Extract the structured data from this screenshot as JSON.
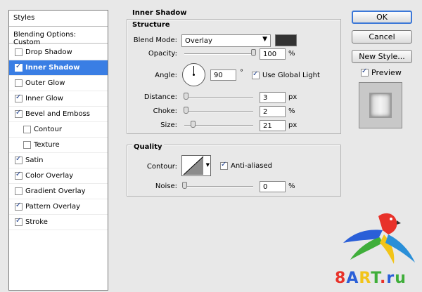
{
  "styles_panel": {
    "header": "Styles",
    "blending_options": "Blending Options: Custom",
    "items": [
      {
        "label": "Drop Shadow",
        "checked": false,
        "selected": false,
        "sub": false
      },
      {
        "label": "Inner Shadow",
        "checked": true,
        "selected": true,
        "sub": false
      },
      {
        "label": "Outer Glow",
        "checked": false,
        "selected": false,
        "sub": false
      },
      {
        "label": "Inner Glow",
        "checked": true,
        "selected": false,
        "sub": false
      },
      {
        "label": "Bevel and Emboss",
        "checked": true,
        "selected": false,
        "sub": false
      },
      {
        "label": "Contour",
        "checked": false,
        "selected": false,
        "sub": true
      },
      {
        "label": "Texture",
        "checked": false,
        "selected": false,
        "sub": true
      },
      {
        "label": "Satin",
        "checked": true,
        "selected": false,
        "sub": false
      },
      {
        "label": "Color Overlay",
        "checked": true,
        "selected": false,
        "sub": false
      },
      {
        "label": "Gradient Overlay",
        "checked": false,
        "selected": false,
        "sub": false
      },
      {
        "label": "Pattern Overlay",
        "checked": true,
        "selected": false,
        "sub": false
      },
      {
        "label": "Stroke",
        "checked": true,
        "selected": false,
        "sub": false
      }
    ]
  },
  "inner_shadow": {
    "title": "Inner Shadow",
    "structure": {
      "title": "Structure",
      "blend_mode_label": "Blend Mode:",
      "blend_mode_value": "Overlay",
      "swatch_color": "#333333",
      "opacity_label": "Opacity:",
      "opacity_value": "100",
      "opacity_unit": "%",
      "opacity_fraction": 1.0,
      "angle_label": "Angle:",
      "angle_value": "90",
      "angle_unit": "°",
      "use_global_light_label": "Use Global Light",
      "use_global_light_checked": true,
      "distance_label": "Distance:",
      "distance_value": "3",
      "distance_unit": "px",
      "choke_label": "Choke:",
      "choke_value": "2",
      "choke_unit": "%",
      "size_label": "Size:",
      "size_value": "21",
      "size_unit": "px"
    },
    "quality": {
      "title": "Quality",
      "contour_label": "Contour:",
      "anti_aliased_label": "Anti-aliased",
      "anti_aliased_checked": true,
      "noise_label": "Noise:",
      "noise_value": "0",
      "noise_unit": "%"
    }
  },
  "buttons": {
    "ok": "OK",
    "cancel": "Cancel",
    "new_style": "New Style...",
    "preview_label": "Preview",
    "preview_checked": true
  },
  "watermark": {
    "text": "8ART.ru",
    "colors": {
      "red": "#e8322a",
      "blue": "#2a5fd8",
      "yellow": "#f2c418",
      "green": "#3fae3a"
    }
  }
}
